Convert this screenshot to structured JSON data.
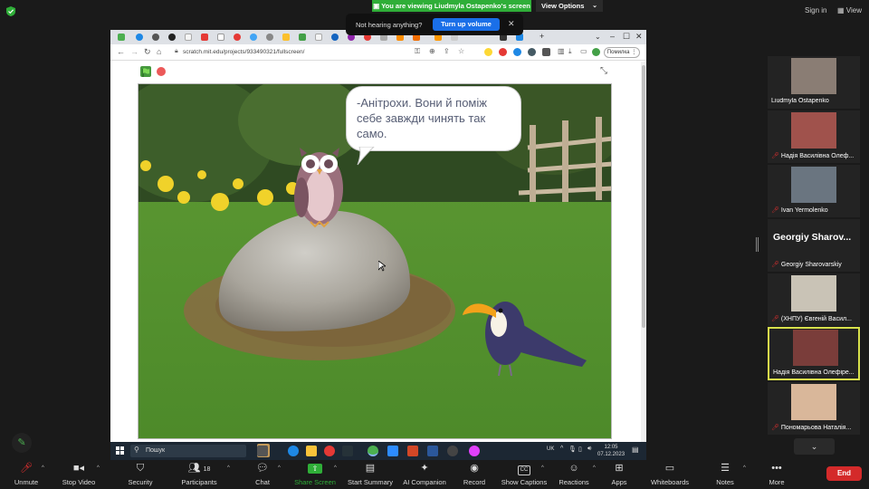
{
  "zoom": {
    "share_banner": "You are viewing Liudmyla Ostapenko's screen",
    "view_options": "View Options",
    "sign_in": "Sign in",
    "view": "View",
    "hearing_prompt": "Not hearing anything?",
    "turn_up_volume": "Turn up volume"
  },
  "browser": {
    "url": "scratch.mit.edu/projects/933490321/fullscreen/",
    "error_label": "Помилка"
  },
  "scratch": {
    "speech": "-Анітрохи. Вони й поміж себе завжди чинять так само."
  },
  "taskbar": {
    "search_label": "Пошук",
    "lang": "UK",
    "time": "12:05",
    "date": "07.12.2023"
  },
  "participants": [
    {
      "name": "Liudmyla Ostapenko",
      "muted": false
    },
    {
      "name": "Надія Василівна Олеф...",
      "muted": true
    },
    {
      "name": "Ivan Yermolenko",
      "muted": true
    },
    {
      "name": "Georgiy Sharovarskiy",
      "muted": true,
      "display_name": "Georgiy Sharov..."
    },
    {
      "name": "(ХНПУ) Євгеній Васил...",
      "muted": true
    },
    {
      "name": "Надія Василівна Олефіре...",
      "muted": false
    },
    {
      "name": "Пономарьова Наталія...",
      "muted": true
    }
  ],
  "toolbar": {
    "unmute": "Unmute",
    "stop_video": "Stop Video",
    "security": "Security",
    "participants": "Participants",
    "participants_count": "18",
    "chat": "Chat",
    "share_screen": "Share Screen",
    "start_summary": "Start Summary",
    "ai_companion": "AI Companion",
    "record": "Record",
    "show_captions": "Show Captions",
    "reactions": "Reactions",
    "apps": "Apps",
    "whiteboards": "Whiteboards",
    "notes": "Notes",
    "more": "More",
    "end": "End"
  },
  "colors": {
    "share_green": "#2fae38",
    "volume_blue": "#1a6fe8",
    "end_red": "#d42a2a",
    "active_border": "#d7e04b"
  }
}
